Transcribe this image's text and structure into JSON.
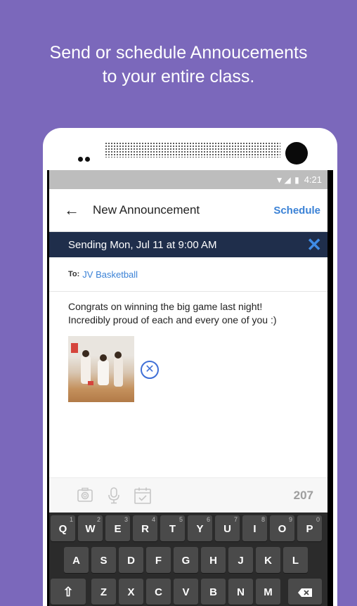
{
  "headline": {
    "line1": "Send or schedule Annoucements",
    "line2": "to your entire class."
  },
  "status_bar": {
    "icons": "▼◢ ▮",
    "time": "4:21"
  },
  "app_bar": {
    "back_icon": "back-arrow-icon",
    "title": "New Announcement",
    "schedule_label": "Schedule"
  },
  "sending_bar": {
    "text": "Sending Mon, Jul 11 at 9:00 AM",
    "close_icon": "close-icon"
  },
  "recipient": {
    "label": "To:",
    "value": "JV Basketball"
  },
  "message": {
    "line1": "Congrats on winning the big game last night!",
    "line2": "Incredibly proud of each and every one of you :)"
  },
  "toolbar": {
    "icons": [
      "camera-icon",
      "microphone-icon",
      "calendar-icon"
    ],
    "char_count": "207"
  },
  "keyboard": {
    "row1": [
      {
        "key": "Q",
        "hint": "1"
      },
      {
        "key": "W",
        "hint": "2"
      },
      {
        "key": "E",
        "hint": "3"
      },
      {
        "key": "R",
        "hint": "4"
      },
      {
        "key": "T",
        "hint": "5"
      },
      {
        "key": "Y",
        "hint": "6"
      },
      {
        "key": "U",
        "hint": "7"
      },
      {
        "key": "I",
        "hint": "8"
      },
      {
        "key": "O",
        "hint": "9"
      },
      {
        "key": "P",
        "hint": "0"
      }
    ],
    "row2": [
      "A",
      "S",
      "D",
      "F",
      "G",
      "H",
      "J",
      "K",
      "L"
    ],
    "row3": [
      "Z",
      "X",
      "C",
      "V",
      "B",
      "N",
      "M"
    ],
    "shift_icon": "shift-icon",
    "backspace_icon": "backspace-icon"
  },
  "colors": {
    "background": "#7b68bb",
    "navy_bar": "#1f2e4b",
    "accent_blue": "#3b82d6"
  }
}
